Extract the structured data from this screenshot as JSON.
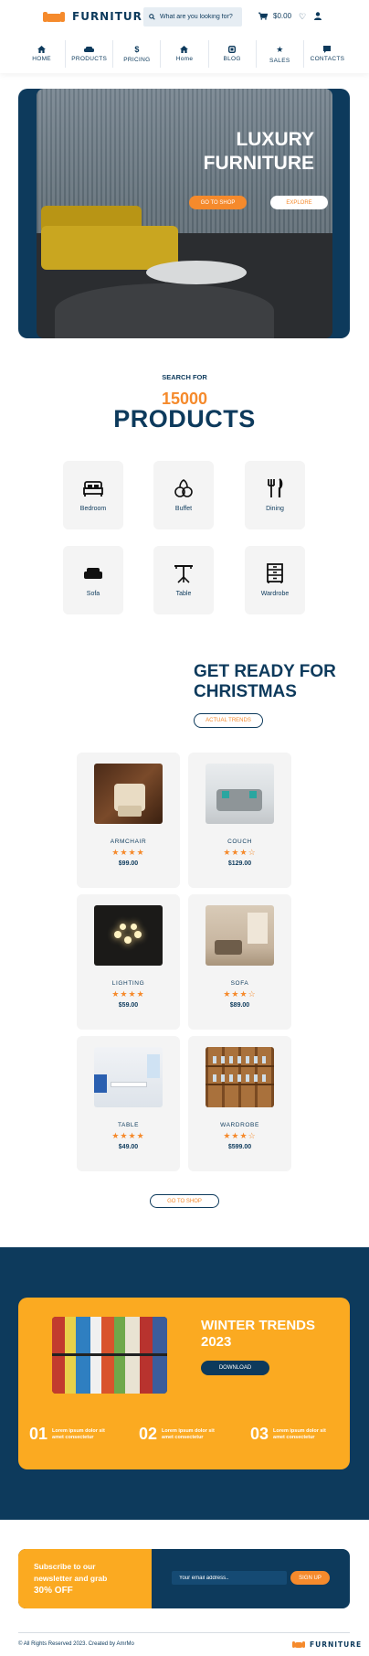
{
  "header": {
    "logo_text": "FURNITURE",
    "search_placeholder": "What are you looking for?",
    "cart_total": "$0.00"
  },
  "nav": [
    {
      "label": "HOME",
      "icon": "home-icon"
    },
    {
      "label": "PRODUCTS",
      "icon": "sofa-icon"
    },
    {
      "label": "PRICING",
      "icon": "dollar-icon"
    },
    {
      "label": "Home",
      "icon": "home-icon"
    },
    {
      "label": "BLOG",
      "icon": "blog-icon"
    },
    {
      "label": "SALES",
      "icon": "star-icon"
    },
    {
      "label": "CONTACTS",
      "icon": "chat-icon"
    }
  ],
  "hero": {
    "title_line1": "LUXURY",
    "title_line2": "FURNITURE",
    "shop_button": "GO TO SHOP",
    "explore_button": "EXPLORE"
  },
  "search_section": {
    "label": "SEARCH FOR",
    "number": "15000",
    "title": "PRODUCTS",
    "categories": [
      {
        "label": "Bedroom",
        "icon": "bed-icon"
      },
      {
        "label": "Buffet",
        "icon": "buffet-icon"
      },
      {
        "label": "Dining",
        "icon": "dining-icon"
      },
      {
        "label": "Sofa",
        "icon": "sofa-icon"
      },
      {
        "label": "Table",
        "icon": "table-icon"
      },
      {
        "label": "Wardrobe",
        "icon": "wardrobe-icon"
      }
    ]
  },
  "christmas": {
    "title_line1": "GET READY FOR",
    "title_line2": "CHRISTMAS",
    "trends_button": "ACTUAL TRENDS",
    "products": [
      {
        "name": "ARMCHAIR",
        "rating": 4,
        "stars": "★★★★",
        "price": "$99.00"
      },
      {
        "name": "COUCH",
        "rating": 3,
        "stars": "★★★☆",
        "price": "$129.00"
      },
      {
        "name": "LIGHTING",
        "rating": 4,
        "stars": "★★★★",
        "price": "$59.00"
      },
      {
        "name": "SOFA",
        "rating": 3,
        "stars": "★★★☆",
        "price": "$89.00"
      },
      {
        "name": "TABLE",
        "rating": 4,
        "stars": "★★★★",
        "price": "$49.00"
      },
      {
        "name": "WARDROBE",
        "rating": 3,
        "stars": "★★★☆",
        "price": "$599.00"
      }
    ],
    "shop_button": "GO TO SHOP"
  },
  "winter": {
    "title_line1": "WINTER TRENDS",
    "title_line2": "2023",
    "download_button": "DOWNLOAD",
    "steps": [
      {
        "num": "01",
        "text": "Lorem ipsum dolor sit amet consectetur"
      },
      {
        "num": "02",
        "text": "Lorem ipsum dolor sit amet consectetur"
      },
      {
        "num": "03",
        "text": "Lorem ipsum dolor sit amet consectetur"
      }
    ]
  },
  "newsletter": {
    "line1": "Subscribe to our",
    "line2": "newsletter and grab",
    "offer": "30% OFF",
    "email_placeholder": "Your email address..",
    "signup_button": "SIGN UP"
  },
  "footer": {
    "copyright": "© All Rights Reserved 2023. Created by AmrMo",
    "logo_text": "FURNITURE"
  },
  "colors": {
    "navy": "#0d3a5c",
    "orange": "#f58a2c",
    "yellow": "#fbaa21"
  }
}
